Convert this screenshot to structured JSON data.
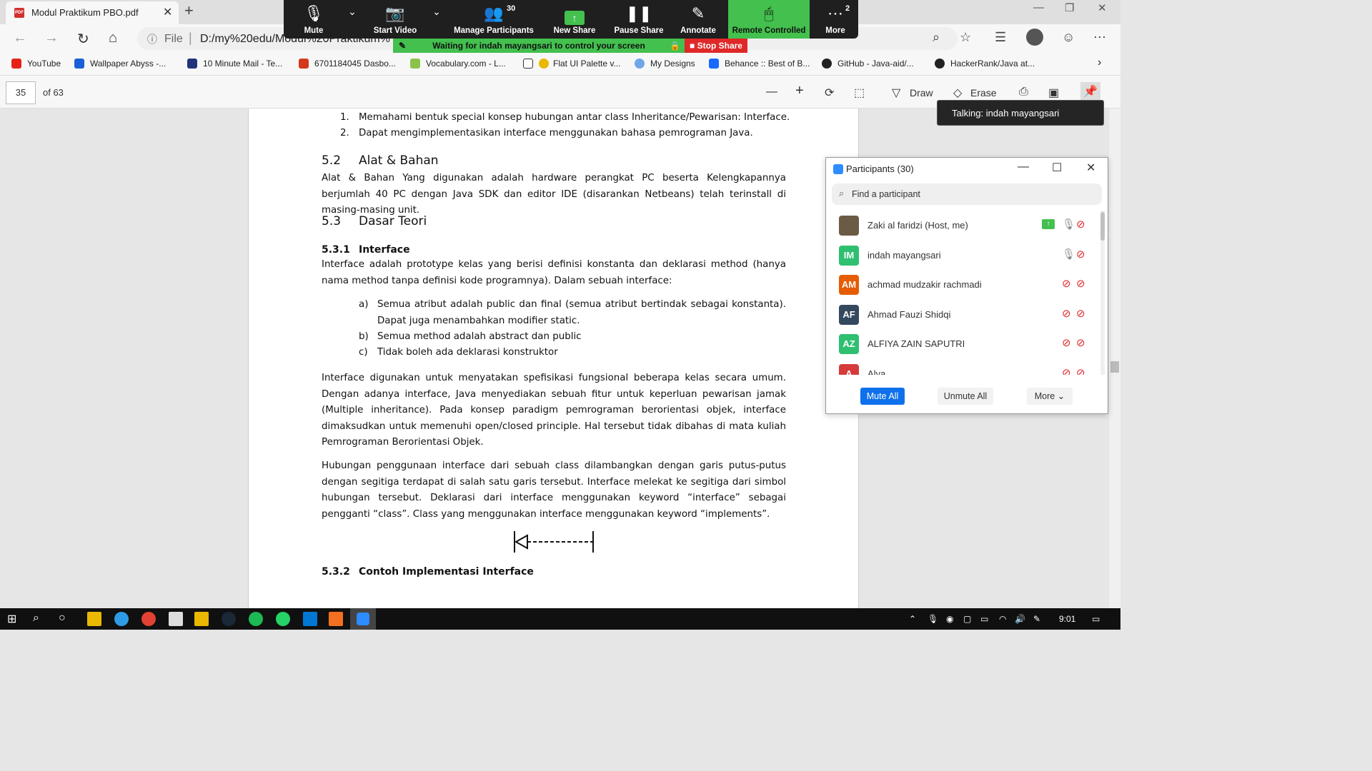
{
  "browser": {
    "tab_title": "Modul Praktikum PBO.pdf",
    "pdf_badge": "PDF",
    "new_tab": "+",
    "address": {
      "info_icon": "ⓘ",
      "scheme_label": "File",
      "separator": "|",
      "url": "D:/my%20edu/Modul%20Praktikum%"
    },
    "bookmarks": [
      {
        "label": "YouTube",
        "icon": "youtube-icon",
        "color": "#e62117"
      },
      {
        "label": "Wallpaper Abyss -...",
        "icon": "wallpaper-abyss-icon",
        "color": "#1a5fd6"
      },
      {
        "label": "10 Minute Mail - Te...",
        "icon": "ten-minute-mail-icon",
        "color": "#22337a"
      },
      {
        "label": "6701184045 Dasbo...",
        "icon": "dashboard-icon",
        "color": "#d23a1b"
      },
      {
        "label": "Vocabulary.com - L...",
        "icon": "vocabulary-icon",
        "color": "#8bc34a"
      },
      {
        "label": "Flat UI Palette v...",
        "icon": "page-icon",
        "color": "#ffffff"
      },
      {
        "label": "My Designs",
        "icon": "designs-icon",
        "color": "#e9b800"
      },
      {
        "label": "Behance :: Best of B...",
        "icon": "behance-icon",
        "color": "#6fa6e8"
      },
      {
        "label": "GitHub - Java-aid/...",
        "icon": "behance-logo-icon",
        "color": "#1769ff"
      },
      {
        "label": "HackerRank/Java at...",
        "icon": "github-icon",
        "color": "#222222"
      }
    ]
  },
  "pdf_toolbar": {
    "page_current": "35",
    "page_total": "of 63",
    "draw_label": "Draw",
    "erase_label": "Erase"
  },
  "zoom_bar": {
    "mute": "Mute",
    "start_video": "Start Video",
    "participants_count": "30",
    "manage_participants": "Manage Participants",
    "new_share": "New Share",
    "pause_share": "Pause Share",
    "annotate": "Annotate",
    "remote_controlled": "Remote Controlled",
    "more_count": "2",
    "more": "More",
    "waiting_banner": "Waiting for indah mayangsari to control your screen",
    "stop_share": "Stop Share",
    "accent_green": "#43c04e",
    "stop_red": "#e02828"
  },
  "talking_tooltip": "Talking: indah mayangsari",
  "participants_panel": {
    "title": "Participants (30)",
    "search_placeholder": "Find a participant",
    "participants": [
      {
        "initials": "",
        "name": "Zaki al faridzi (Host, me)",
        "avatar_color": "#6b5b45",
        "sharing": true,
        "mic": "on",
        "video": "off"
      },
      {
        "initials": "IM",
        "name": "indah mayangsari",
        "avatar_color": "#2fbf71",
        "sharing": false,
        "mic": "on",
        "video": "off"
      },
      {
        "initials": "AM",
        "name": "achmad mudzakir rachmadi",
        "avatar_color": "#e65c00",
        "sharing": false,
        "mic": "muted",
        "video": "off"
      },
      {
        "initials": "AF",
        "name": "Ahmad Fauzi Shidqi",
        "avatar_color": "#34495e",
        "sharing": false,
        "mic": "muted",
        "video": "off"
      },
      {
        "initials": "AZ",
        "name": "ALFIYA ZAIN SAPUTRI",
        "avatar_color": "#2fbf71",
        "sharing": false,
        "mic": "muted",
        "video": "off"
      },
      {
        "initials": "A",
        "name": "Alya",
        "avatar_color": "#d63b3b",
        "sharing": false,
        "mic": "muted",
        "video": "off"
      }
    ],
    "mute_all": "Mute All",
    "unmute_all": "Unmute All",
    "more": "More"
  },
  "document": {
    "list_top": [
      {
        "num": "1.",
        "text": "Memahami bentuk special konsep hubungan antar class Inheritance/Pewarisan: Interface."
      },
      {
        "num": "2.",
        "text": "Dapat mengimplementasikan interface menggunakan bahasa pemrograman Java."
      }
    ],
    "s52_num": "5.2",
    "s52_title": "Alat & Bahan",
    "s52_body": "Alat & Bahan Yang digunakan adalah hardware perangkat PC beserta Kelengkapannya berjumlah 40 PC dengan Java SDK dan editor IDE (disarankan Netbeans) telah terinstall di masing-masing unit.",
    "s53_num": "5.3",
    "s53_title": "Dasar Teori",
    "s531_num": "5.3.1",
    "s531_title": "Interface",
    "s531_body": "Interface adalah prototype kelas yang berisi definisi konstanta dan deklarasi method (hanya nama method tanpa definisi kode programnya). Dalam sebuah interface:",
    "sublist": [
      {
        "num": "a)",
        "text": "Semua atribut adalah public dan final (semua atribut bertindak sebagai konstanta). Dapat juga menambahkan modifier static."
      },
      {
        "num": "b)",
        "text": "Semua method adalah abstract dan public"
      },
      {
        "num": "c)",
        "text": "Tidak boleh ada deklarasi konstruktor"
      }
    ],
    "para2": "Interface digunakan untuk menyatakan spefisikasi fungsional beberapa kelas secara umum. Dengan adanya interface, Java menyediakan sebuah fitur untuk keperluan pewarisan jamak (Multiple inheritance). Pada konsep paradigm pemrograman berorientasi objek, interface dimaksudkan untuk memenuhi open/closed principle. Hal tersebut tidak dibahas di mata kuliah Pemrograman Berorientasi Objek.",
    "para3": "Hubungan penggunaan interface dari sebuah class dilambangkan dengan garis putus-putus dengan segitiga terdapat di salah satu garis tersebut. Interface melekat ke segitiga dari simbol hubungan tersebut. Deklarasi dari interface menggunakan keyword “interface” sebagai pengganti “class”. Class yang menggunakan interface menggunakan keyword “implements”.",
    "s532_num": "5.3.2",
    "s532_title": "Contoh Implementasi Interface"
  },
  "taskbar": {
    "time": "9:01"
  }
}
